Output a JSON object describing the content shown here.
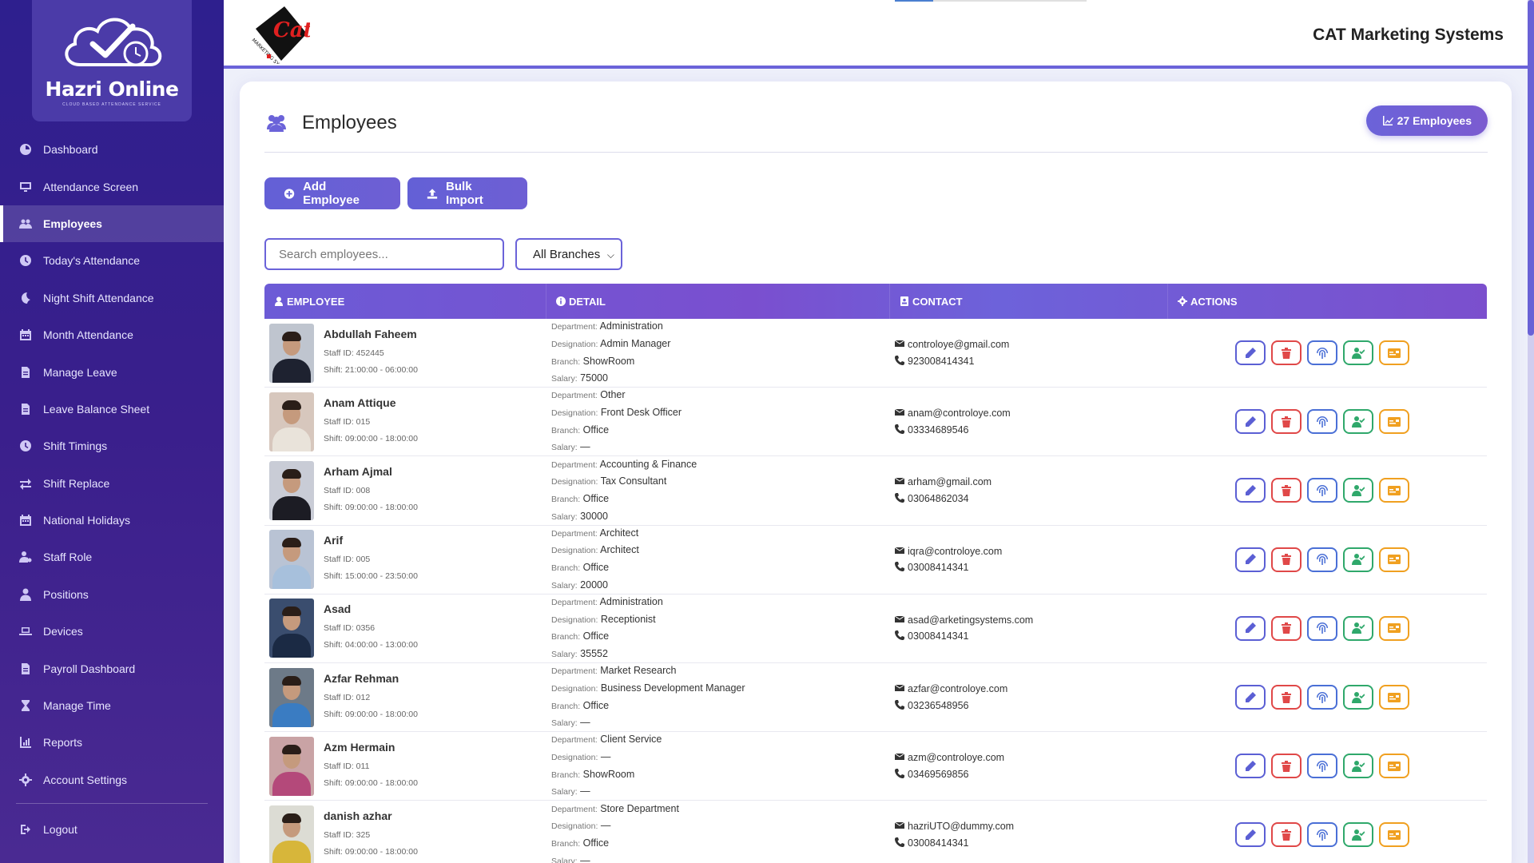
{
  "brand": {
    "name": "Hazri Online",
    "tagline": "CLOUD BASED ATTENDANCE SERVICE"
  },
  "header": {
    "company": "CAT Marketing Systems",
    "logo_text": "Cat",
    "logo_sub": "MARKETING SYSTEMS"
  },
  "sidebar": {
    "items": [
      {
        "label": "Dashboard",
        "icon": "dashboard-icon"
      },
      {
        "label": "Attendance Screen",
        "icon": "monitor-icon"
      },
      {
        "label": "Employees",
        "icon": "users-icon",
        "active": true
      },
      {
        "label": "Today's Attendance",
        "icon": "clock-icon"
      },
      {
        "label": "Night Shift Attendance",
        "icon": "moon-icon"
      },
      {
        "label": "Month Attendance",
        "icon": "calendar-icon"
      },
      {
        "label": "Manage Leave",
        "icon": "document-icon"
      },
      {
        "label": "Leave Balance Sheet",
        "icon": "document-icon"
      },
      {
        "label": "Shift Timings",
        "icon": "clock-icon"
      },
      {
        "label": "Shift Replace",
        "icon": "swap-icon"
      },
      {
        "label": "National Holidays",
        "icon": "calendar-icon"
      },
      {
        "label": "Staff Role",
        "icon": "user-gear-icon"
      },
      {
        "label": "Positions",
        "icon": "user-icon"
      },
      {
        "label": "Devices",
        "icon": "laptop-icon"
      },
      {
        "label": "Payroll Dashboard",
        "icon": "document-icon"
      },
      {
        "label": "Manage Time",
        "icon": "hourglass-icon"
      },
      {
        "label": "Reports",
        "icon": "chart-icon"
      },
      {
        "label": "Account Settings",
        "icon": "gear-icon"
      }
    ],
    "logout": "Logout"
  },
  "page": {
    "title": "Employees",
    "count_badge": "27 Employees",
    "add_button": "Add Employee",
    "import_button": "Bulk Import",
    "search_placeholder": "Search employees...",
    "branch_filter": "All Branches"
  },
  "table": {
    "headers": {
      "employee": "EMPLOYEE",
      "detail": "DETAIL",
      "contact": "CONTACT",
      "actions": "ACTIONS"
    },
    "labels": {
      "staff_id": "Staff ID:",
      "shift": "Shift:",
      "department": "Department:",
      "designation": "Designation:",
      "branch": "Branch:",
      "salary": "Salary:"
    },
    "rows": [
      {
        "name": "Abdullah Faheem",
        "staff_id": "452445",
        "shift": "21:00:00 - 06:00:00",
        "department": "Administration",
        "designation": "Admin Manager",
        "branch": "ShowRoom",
        "salary": "75000",
        "email": "controloye@gmail.com",
        "phone": "923008414341"
      },
      {
        "name": "Anam Attique",
        "staff_id": "015",
        "shift": "09:00:00 - 18:00:00",
        "department": "Other",
        "designation": "Front Desk Officer",
        "branch": "Office",
        "salary": "—",
        "email": "anam@controloye.com",
        "phone": "03334689546"
      },
      {
        "name": "Arham Ajmal",
        "staff_id": "008",
        "shift": "09:00:00 - 18:00:00",
        "department": "Accounting & Finance",
        "designation": "Tax Consultant",
        "branch": "Office",
        "salary": "30000",
        "email": "arham@gmail.com",
        "phone": "03064862034"
      },
      {
        "name": "Arif",
        "staff_id": "005",
        "shift": "15:00:00 - 23:50:00",
        "department": "Architect",
        "designation": "Architect",
        "branch": "Office",
        "salary": "20000",
        "email": "iqra@controloye.com",
        "phone": "03008414341"
      },
      {
        "name": "Asad",
        "staff_id": "0356",
        "shift": "04:00:00 - 13:00:00",
        "department": "Administration",
        "designation": "Receptionist",
        "branch": "Office",
        "salary": "35552",
        "email": "asad@arketingsystems.com",
        "phone": "03008414341"
      },
      {
        "name": "Azfar Rehman",
        "staff_id": "012",
        "shift": "09:00:00 - 18:00:00",
        "department": "Market Research",
        "designation": "Business Development Manager",
        "branch": "Office",
        "salary": "—",
        "email": "azfar@controloye.com",
        "phone": "03236548956"
      },
      {
        "name": "Azm Hermain",
        "staff_id": "011",
        "shift": "09:00:00 - 18:00:00",
        "department": "Client Service",
        "designation": "—",
        "branch": "ShowRoom",
        "salary": "—",
        "email": "azm@controloye.com",
        "phone": "03469569856"
      },
      {
        "name": "danish azhar",
        "staff_id": "325",
        "shift": "09:00:00 - 18:00:00",
        "department": "Store Department",
        "designation": "—",
        "branch": "Office",
        "salary": "—",
        "email": "hazriUTO@dummy.com",
        "phone": "03008414341"
      }
    ]
  }
}
